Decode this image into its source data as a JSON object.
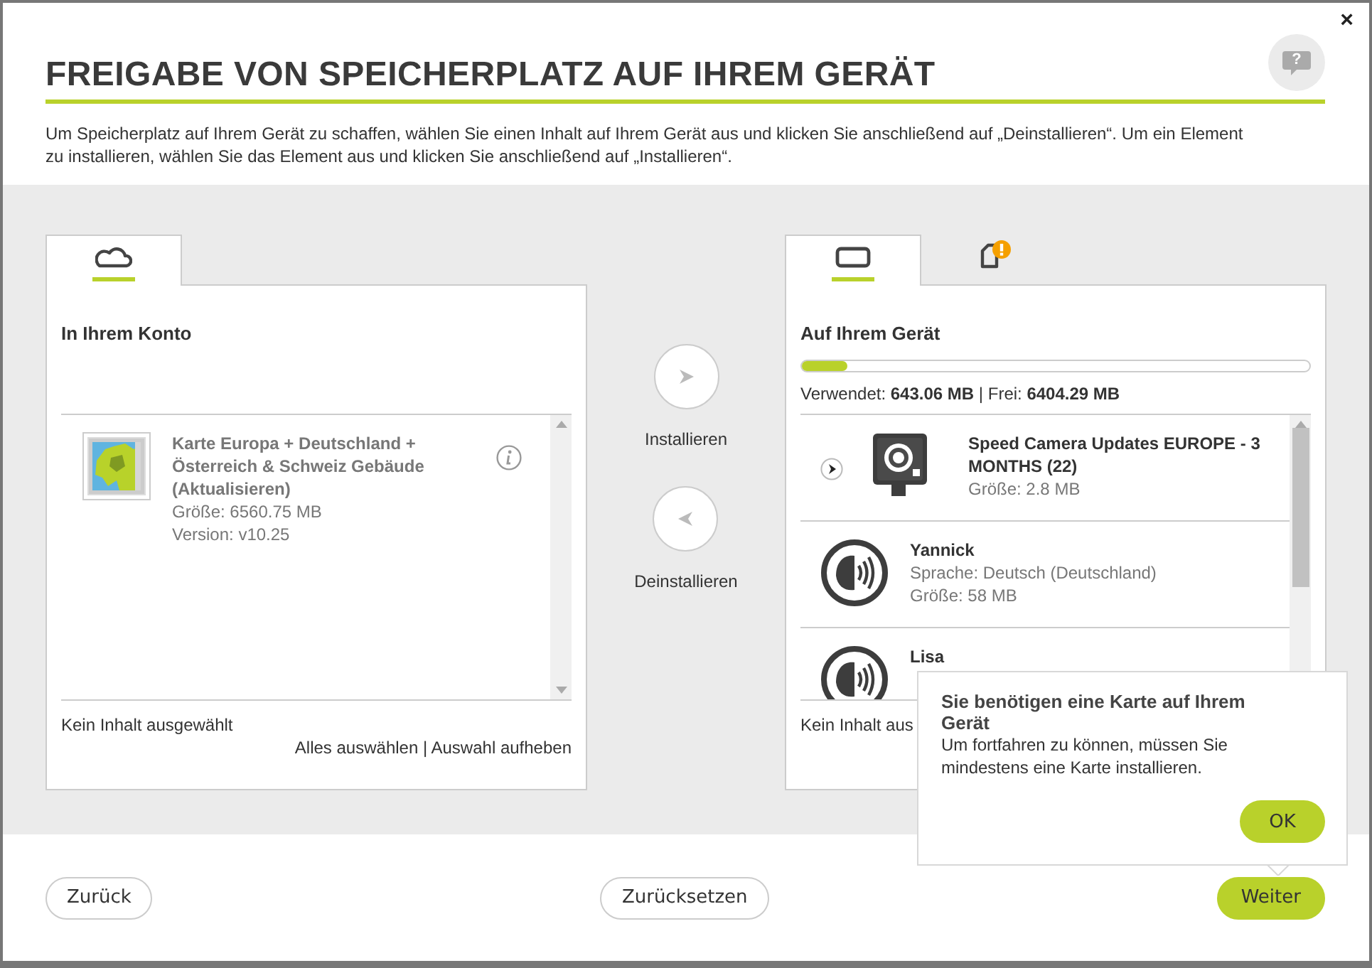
{
  "window": {
    "close": "×"
  },
  "header": {
    "title": "FREIGABE VON SPEICHERPLATZ AUF IHREM GERÄT",
    "help": "?",
    "description": "Um Speicherplatz auf Ihrem Gerät zu schaffen, wählen Sie einen Inhalt auf Ihrem Gerät aus und klicken Sie anschließend auf „Deinstallieren“. Um ein Element zu installieren, wählen Sie das Element aus und klicken Sie anschließend auf „Installieren“."
  },
  "left_panel": {
    "tabs": [
      {
        "kind": "cloud",
        "selected": true,
        "warning": false
      }
    ],
    "heading": "In Ihrem Konto",
    "items": [
      {
        "kind": "map",
        "expandable": false,
        "info": true,
        "title": "Karte Europa + Deutschland + Österreich & Schweiz Gebäude (Aktualisieren)",
        "lines": [
          "Größe: 6560.75 MB",
          "Version: v10.25"
        ]
      }
    ],
    "scroll_thumb": false,
    "status": "Kein Inhalt ausgewählt",
    "links": [
      "Alles auswählen",
      "Auswahl aufheben"
    ],
    "separator": "|"
  },
  "transfer": [
    {
      "kind": "install",
      "label": "Installieren"
    },
    {
      "kind": "uninstall",
      "label": "Deinstallieren"
    }
  ],
  "right_panel": {
    "tabs": [
      {
        "kind": "device",
        "selected": true,
        "warning": false
      },
      {
        "kind": "card",
        "selected": false,
        "warning": true
      }
    ],
    "heading": "Auf Ihrem Gerät",
    "storage": {
      "level": 0.09,
      "usage": "Verwendet: **643.06 MB** | Frei: **6404.29 MB**"
    },
    "items": [
      {
        "kind": "camera",
        "expandable": true,
        "info": false,
        "title": "Speed Camera Updates EUROPE - 3 MONTHS (22)",
        "lines": [
          "Größe: 2.8 MB"
        ]
      },
      {
        "kind": "voice",
        "expandable": false,
        "info": false,
        "title": "Yannick",
        "lines": [
          "Sprache: Deutsch (Deutschland)",
          "Größe: 58 MB"
        ]
      },
      {
        "kind": "voice",
        "expandable": false,
        "info": false,
        "title": "Lisa"
      }
    ],
    "scroll_thumb": true,
    "status": "Kein Inhalt aus"
  },
  "footer": {
    "buttons": [
      {
        "label": "Zurück",
        "kind": "outline"
      },
      {
        "label": "Zurücksetzen",
        "kind": "outline"
      },
      {
        "label": "Weiter",
        "kind": "primary"
      }
    ]
  },
  "tooltip": {
    "title": "Sie benötigen eine Karte auf Ihrem Gerät",
    "text": "Um fortfahren zu können, müssen Sie mindestens eine Karte installieren.",
    "button": "OK"
  }
}
